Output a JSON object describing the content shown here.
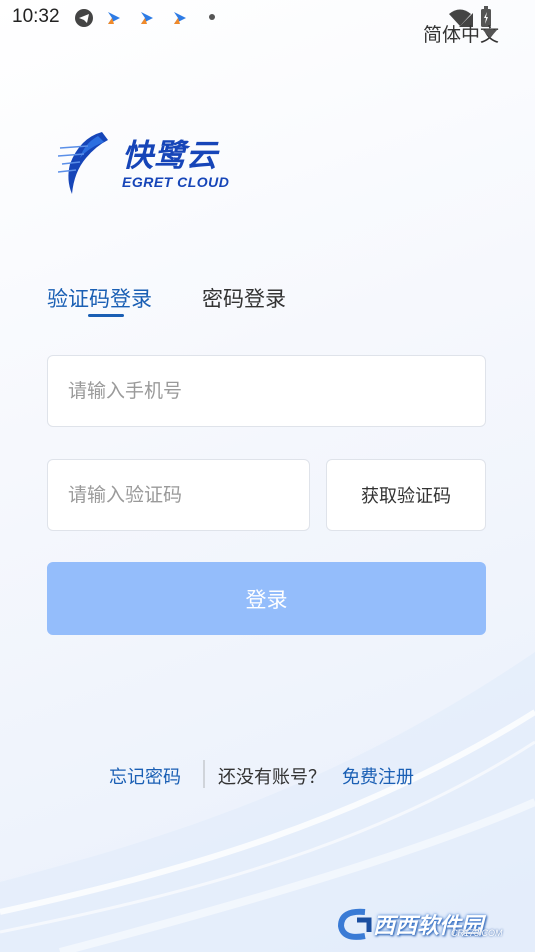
{
  "status_bar": {
    "time": "10:32",
    "icons": [
      "telegram-icon",
      "notification-icon",
      "notification-icon",
      "notification-icon",
      "more-dot-icon",
      "wifi-icon",
      "signal-icon",
      "battery-icon"
    ]
  },
  "language": {
    "selected": "简体中文"
  },
  "logo": {
    "name_cn": "快鹭云",
    "name_en": "EGRET CLOUD"
  },
  "tabs": [
    {
      "label": "验证码登录",
      "active": true
    },
    {
      "label": "密码登录",
      "active": false
    }
  ],
  "form": {
    "phone_placeholder": "请输入手机号",
    "code_placeholder": "请输入验证码",
    "get_code_label": "获取验证码",
    "login_label": "登录"
  },
  "footer": {
    "forgot_password": "忘记密码",
    "no_account": "还没有账号？",
    "register": "免费注册"
  },
  "watermark": {
    "text": "西西软件园",
    "sub": "CR173.COM"
  },
  "colors": {
    "accent": "#1a5fb4",
    "logo_blue": "#1645b8",
    "login_button": "#94bdfb",
    "border": "#dfe3ea"
  }
}
